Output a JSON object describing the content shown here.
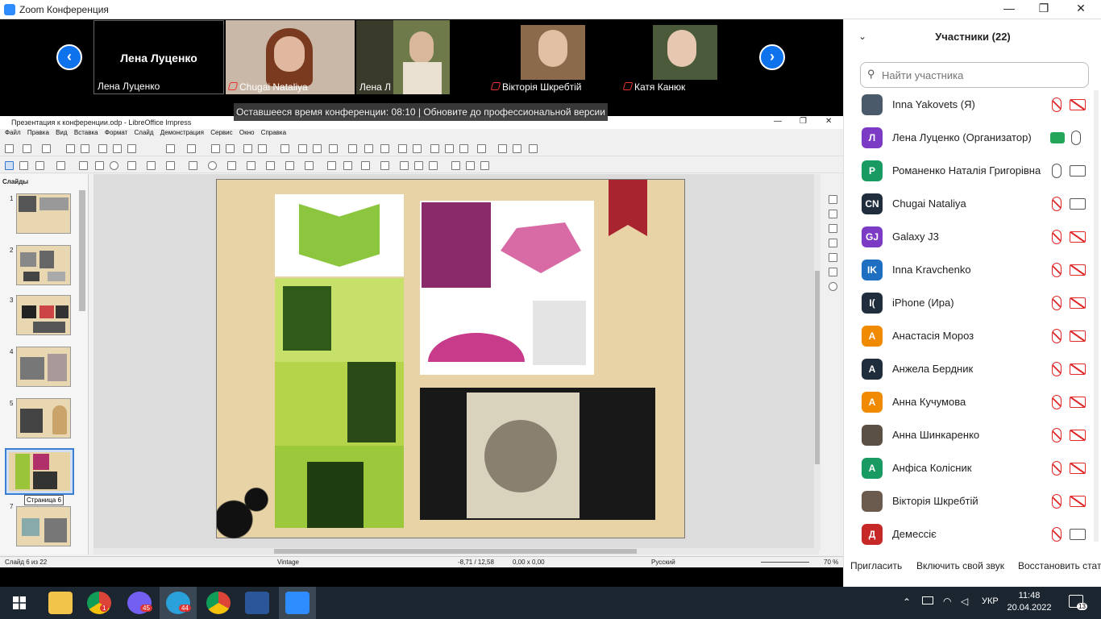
{
  "window": {
    "title": "Zoom Конференция",
    "minimize": "—",
    "maximize": "❐",
    "close": "✕"
  },
  "video_strip": {
    "active_speaker_big": "Лена Луценко",
    "tiles": [
      {
        "name": "Лена Луценко",
        "muted": false
      },
      {
        "name": "Chugai Nataliya",
        "muted": true
      },
      {
        "name": "Лена Л",
        "muted": false
      },
      {
        "name": "Вікторія Шкребтій",
        "muted": true
      },
      {
        "name": "Катя Канюк",
        "muted": true
      }
    ],
    "prev": "‹",
    "next": "›",
    "time_notice": "Оставшееся время конференции: 08:10 | Обновите до профессиональной версии"
  },
  "libreoffice": {
    "title": "Презентация к конференции.odp - LibreOffice Impress",
    "menu": [
      "Файл",
      "Правка",
      "Вид",
      "Вставка",
      "Формат",
      "Слайд",
      "Демонстрация",
      "Сервис",
      "Окно",
      "Справка"
    ],
    "slides_header": "Слайды",
    "slide_numbers": [
      "1",
      "2",
      "3",
      "4",
      "5",
      "6",
      "7"
    ],
    "tooltip": "Страница 6",
    "status": {
      "slide": "Слайд 6 из 22",
      "master": "Vintage",
      "position": "-8,71 / 12,58",
      "size": "0,00 x 0,00",
      "language": "Русский",
      "zoom": "70 %"
    }
  },
  "participants": {
    "header": "Участники (22)",
    "search_placeholder": "Найти участника",
    "list": [
      {
        "name": "Inna Yakovets (Я)",
        "initials": "",
        "color": "#4a5a6a",
        "mic": "muted",
        "cam": "off"
      },
      {
        "name": "Лена Луценко (Организатор)",
        "initials": "Л",
        "color": "#7b3bc4",
        "mic": "on",
        "cam": "share"
      },
      {
        "name": "Романенко Наталія Григорівна",
        "initials": "Р",
        "color": "#1a9a63",
        "mic": "on",
        "cam": "on"
      },
      {
        "name": "Chugai Nataliya",
        "initials": "CN",
        "color": "#1f2d3d",
        "mic": "muted",
        "cam": "on"
      },
      {
        "name": "Galaxy J3",
        "initials": "GJ",
        "color": "#7b3bc4",
        "mic": "muted",
        "cam": "off"
      },
      {
        "name": "Inna Kravchenko",
        "initials": "IK",
        "color": "#1e6fc2",
        "mic": "muted",
        "cam": "off"
      },
      {
        "name": "iPhone (Ира)",
        "initials": "I(",
        "color": "#1f2d3d",
        "mic": "muted",
        "cam": "off"
      },
      {
        "name": "Анастасія Мороз",
        "initials": "А",
        "color": "#f08a00",
        "mic": "muted",
        "cam": "off"
      },
      {
        "name": "Анжела Бердник",
        "initials": "А",
        "color": "#1f2d3d",
        "mic": "muted",
        "cam": "off"
      },
      {
        "name": "Анна Кучумова",
        "initials": "А",
        "color": "#f08a00",
        "mic": "muted",
        "cam": "off"
      },
      {
        "name": "Анна Шинкаренко",
        "initials": "",
        "color": "#5b5044",
        "mic": "muted",
        "cam": "off"
      },
      {
        "name": "Анфіса Колісник",
        "initials": "А",
        "color": "#1a9a63",
        "mic": "muted",
        "cam": "off"
      },
      {
        "name": "Вікторія Шкребтій",
        "initials": "",
        "color": "#6b5a4e",
        "mic": "muted",
        "cam": "off"
      },
      {
        "name": "Демессіє",
        "initials": "Д",
        "color": "#c62828",
        "mic": "muted",
        "cam": "on"
      }
    ],
    "footer": {
      "invite": "Пригласить",
      "unmute": "Включить свой звук",
      "restore": "Восстановить стату"
    }
  },
  "taskbar": {
    "time": "11:48",
    "date": "20.04.2022",
    "lang": "УКР",
    "notif": "13",
    "badges": {
      "chrome": "1",
      "viber": "45",
      "telegram": "44"
    }
  },
  "colors": {
    "zoom_blue": "#0e72ed",
    "muted_red": "#e02828",
    "taskbar": "#1b2631"
  }
}
